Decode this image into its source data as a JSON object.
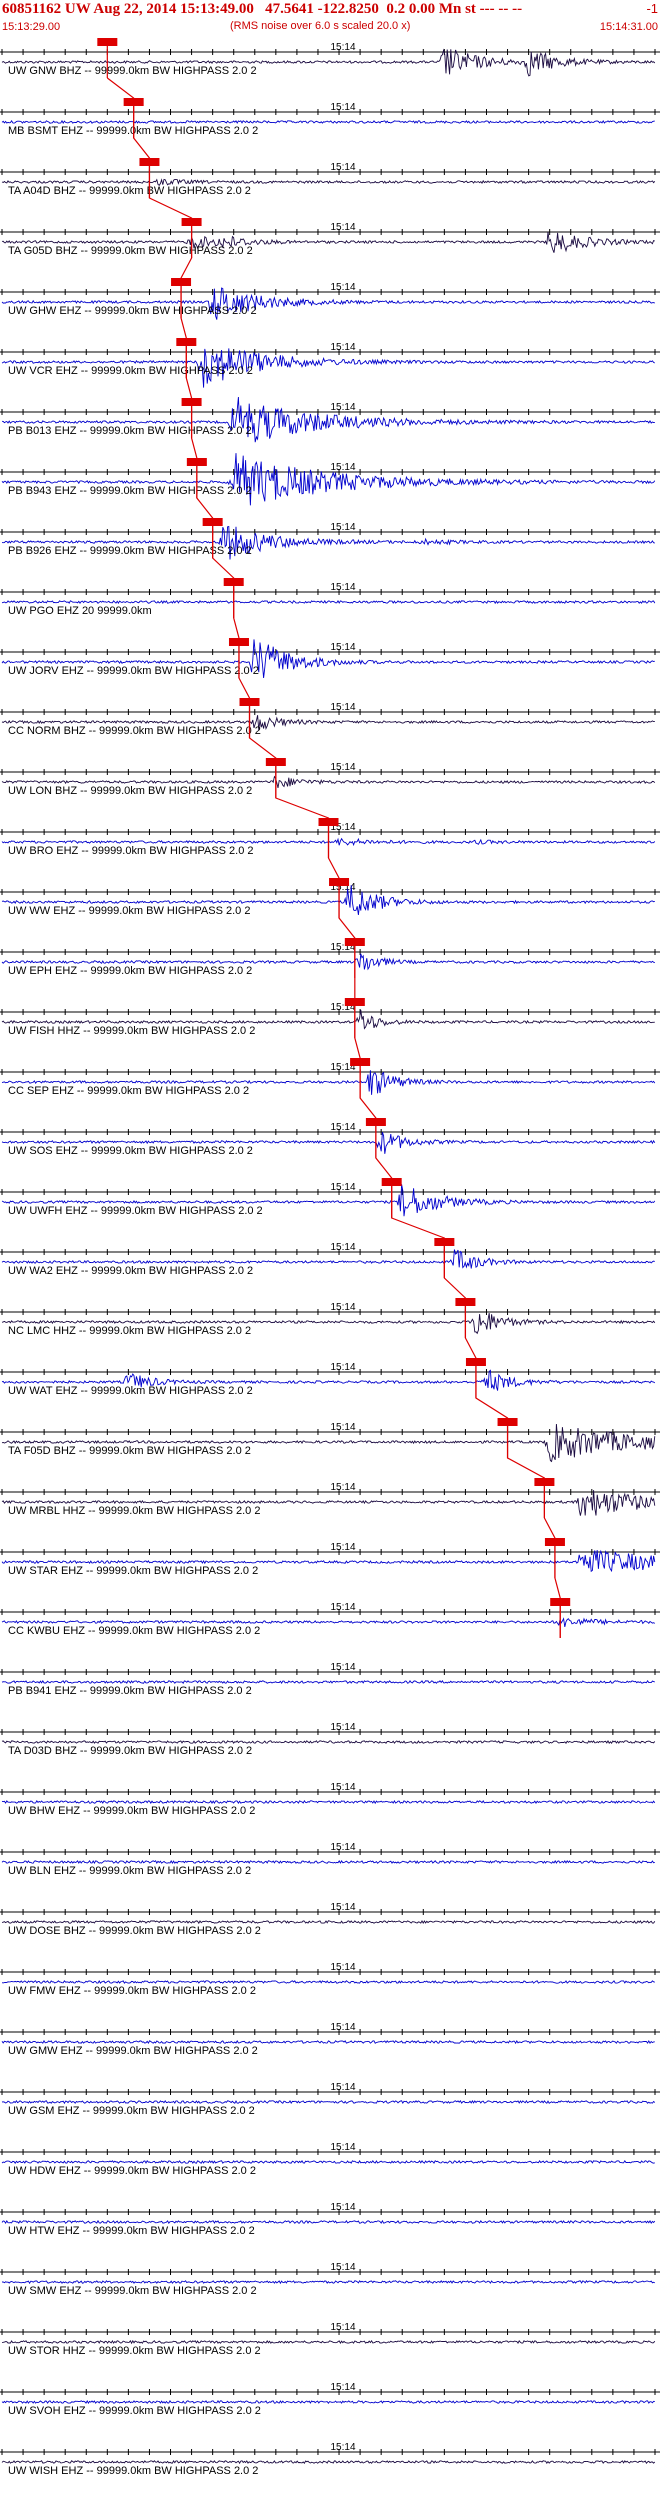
{
  "header": {
    "title": "60851162 UW Aug 22, 2014 15:13:49.00   47.5641 -122.8250  0.2 0.00 Mn st --- -- --",
    "title_suffix": "-1",
    "subtitle": "(RMS noise over 6.0 s scaled 20.0 x)",
    "time_start": "15:13:29.00",
    "time_end": "15:14:31.00",
    "tick_label": "15:14"
  },
  "colors": {
    "header_text": "#cc0000",
    "pick": "#dd0000",
    "blue_trace": "#0000cc",
    "dark_trace": "#1a0a40",
    "axis": "#000000"
  },
  "chart_data": {
    "type": "line",
    "title": "60851162 UW Aug 22, 2014 15:13:49.00",
    "xlabel": "",
    "ylabel": "",
    "xlim": [
      "15:13:29.00",
      "15:14:31.00"
    ],
    "x_tick_center": "15:14",
    "pick_label": "P",
    "series": [
      {
        "name": "UW GNW BHZ -- 99999.0km BW  HIGHPASS  2.0  2",
        "color": "dark",
        "pick_s": 10.0,
        "events": [
          [
            42,
            3,
            5
          ],
          [
            50,
            2.5,
            4
          ]
        ]
      },
      {
        "name": "MB BSMT EHZ -- 99999.0km BW  HIGHPASS  2.0  2",
        "color": "blue",
        "pick_s": 12.5,
        "events": []
      },
      {
        "name": "TA A04D BHZ -- 99999.0km BW  HIGHPASS  2.0  2",
        "color": "dark",
        "pick_s": 14.0,
        "events": [
          [
            15,
            2,
            1
          ]
        ]
      },
      {
        "name": "TA G05D BHZ -- 99999.0km BW  HIGHPASS  2.0  2",
        "color": "dark",
        "pick_s": 18.0,
        "events": [
          [
            18,
            3,
            2
          ],
          [
            21,
            2,
            1.5
          ],
          [
            52,
            3,
            4
          ]
        ]
      },
      {
        "name": "UW GHW EHZ -- 99999.0km BW  HIGHPASS  2.0  2",
        "color": "blue",
        "pick_s": 17.0,
        "events": [
          [
            20,
            4,
            6
          ]
        ]
      },
      {
        "name": "UW VCR EHZ -- 99999.0km BW  HIGHPASS  2.0  2",
        "color": "blue",
        "pick_s": 17.5,
        "events": [
          [
            19,
            5,
            8
          ]
        ]
      },
      {
        "name": "PB B013 EHZ -- 99999.0km BW  HIGHPASS  2.0  2",
        "color": "blue",
        "pick_s": 18.0,
        "events": [
          [
            22,
            7,
            8
          ]
        ]
      },
      {
        "name": "PB B943 EHZ -- 99999.0km BW  HIGHPASS  2.0  2",
        "color": "blue",
        "pick_s": 18.5,
        "events": [
          [
            22,
            8,
            9
          ]
        ]
      },
      {
        "name": "PB B926 EHZ -- 99999.0km BW  HIGHPASS  2.0  2",
        "color": "blue",
        "pick_s": 20.0,
        "events": [
          [
            21,
            4,
            6
          ],
          [
            40,
            3,
            0.6
          ]
        ]
      },
      {
        "name": "UW PGO EHZ 20 99999.0km",
        "color": "blue",
        "pick_s": 22.0,
        "events": []
      },
      {
        "name": "UW JORV EHZ -- 99999.0km BW  HIGHPASS  2.0  2",
        "color": "blue",
        "pick_s": 22.5,
        "events": [
          [
            24,
            3,
            8
          ]
        ]
      },
      {
        "name": "CC NORM BHZ -- 99999.0km BW  HIGHPASS  2.0  2",
        "color": "dark",
        "pick_s": 23.5,
        "events": [
          [
            24,
            2,
            3
          ]
        ]
      },
      {
        "name": "UW LON BHZ -- 99999.0km BW  HIGHPASS  2.0  2",
        "color": "dark",
        "pick_s": 26.0,
        "events": [
          [
            26,
            2,
            2
          ]
        ]
      },
      {
        "name": "UW BRO EHZ -- 99999.0km BW  HIGHPASS  2.0  2",
        "color": "blue",
        "pick_s": 31.0,
        "events": [
          [
            32,
            3,
            1
          ],
          [
            45,
            2,
            0.4
          ]
        ]
      },
      {
        "name": "UW WW EHZ -- 99999.0km BW  HIGHPASS  2.0  2",
        "color": "blue",
        "pick_s": 32.0,
        "events": [
          [
            33,
            2.5,
            6
          ]
        ]
      },
      {
        "name": "UW EPH EHZ -- 99999.0km BW  HIGHPASS  2.0  2",
        "color": "blue",
        "pick_s": 33.5,
        "events": [
          [
            34,
            1.5,
            4
          ]
        ]
      },
      {
        "name": "UW FISH HHZ -- 99999.0km BW  HIGHPASS  2.0  2",
        "color": "dark",
        "pick_s": 33.5,
        "events": [
          [
            34,
            1.5,
            4
          ]
        ]
      },
      {
        "name": "CC SEP EHZ -- 99999.0km BW  HIGHPASS  2.0  2",
        "color": "blue",
        "pick_s": 34.0,
        "events": [
          [
            35,
            2,
            5
          ]
        ]
      },
      {
        "name": "UW SOS EHZ -- 99999.0km BW  HIGHPASS  2.0  2",
        "color": "blue",
        "pick_s": 35.5,
        "events": [
          [
            36,
            2,
            4
          ]
        ]
      },
      {
        "name": "UW UWFH EHZ -- 99999.0km BW  HIGHPASS  2.0  2",
        "color": "blue",
        "pick_s": 37.0,
        "events": [
          [
            38,
            3,
            6
          ]
        ]
      },
      {
        "name": "UW WA2 EHZ -- 99999.0km BW  HIGHPASS  2.0  2",
        "color": "blue",
        "pick_s": 42.0,
        "events": [
          [
            43,
            2,
            4
          ]
        ]
      },
      {
        "name": "NC LMC HHZ -- 99999.0km BW  HIGHPASS  2.0  2",
        "color": "dark",
        "pick_s": 44.0,
        "events": [
          [
            45,
            2,
            5
          ]
        ]
      },
      {
        "name": "UW WAT EHZ -- 99999.0km BW  HIGHPASS  2.0  2",
        "color": "blue",
        "pick_s": 45.0,
        "events": [
          [
            12,
            2,
            3
          ],
          [
            46,
            2,
            4
          ]
        ]
      },
      {
        "name": "TA F05D BHZ -- 99999.0km BW  HIGHPASS  2.0  2",
        "color": "dark",
        "pick_s": 48.0,
        "events": [
          [
            52,
            8,
            6
          ]
        ]
      },
      {
        "name": "UW MRBL HHZ -- 99999.0km BW  HIGHPASS  2.0  2",
        "color": "dark",
        "pick_s": 51.5,
        "events": [
          [
            55,
            6,
            5
          ]
        ]
      },
      {
        "name": "UW STAR EHZ -- 99999.0km BW  HIGHPASS  2.0  2",
        "color": "blue",
        "pick_s": 52.5,
        "events": [
          [
            55,
            9,
            4
          ]
        ]
      },
      {
        "name": "CC KWBU EHZ -- 99999.0km BW  HIGHPASS  2.0  2",
        "color": "blue",
        "pick_s": 53.0,
        "events": [
          [
            53,
            3,
            1.5
          ]
        ]
      },
      {
        "name": "PB B941 EHZ -- 99999.0km BW  HIGHPASS  2.0  2",
        "color": "blue",
        "pick_s": null,
        "events": []
      },
      {
        "name": "TA D03D BHZ -- 99999.0km BW  HIGHPASS  2.0  2",
        "color": "dark",
        "pick_s": null,
        "events": []
      },
      {
        "name": "UW BHW EHZ -- 99999.0km BW  HIGHPASS  2.0  2",
        "color": "blue",
        "pick_s": null,
        "events": []
      },
      {
        "name": "UW BLN EHZ -- 99999.0km BW  HIGHPASS  2.0  2",
        "color": "blue",
        "pick_s": null,
        "events": []
      },
      {
        "name": "UW DOSE BHZ -- 99999.0km BW  HIGHPASS  2.0  2",
        "color": "dark",
        "pick_s": null,
        "events": []
      },
      {
        "name": "UW FMW EHZ -- 99999.0km BW  HIGHPASS  2.0  2",
        "color": "blue",
        "pick_s": null,
        "events": []
      },
      {
        "name": "UW GMW EHZ -- 99999.0km BW  HIGHPASS  2.0  2",
        "color": "blue",
        "pick_s": null,
        "events": []
      },
      {
        "name": "UW GSM EHZ -- 99999.0km BW  HIGHPASS  2.0  2",
        "color": "blue",
        "pick_s": null,
        "events": []
      },
      {
        "name": "UW HDW EHZ -- 99999.0km BW  HIGHPASS  2.0  2",
        "color": "blue",
        "pick_s": null,
        "events": []
      },
      {
        "name": "UW HTW EHZ -- 99999.0km BW  HIGHPASS  2.0  2",
        "color": "blue",
        "pick_s": null,
        "events": []
      },
      {
        "name": "UW SMW EHZ -- 99999.0km BW  HIGHPASS  2.0  2",
        "color": "blue",
        "pick_s": null,
        "events": []
      },
      {
        "name": "UW STOR HHZ -- 99999.0km BW  HIGHPASS  2.0  2",
        "color": "dark",
        "pick_s": null,
        "events": []
      },
      {
        "name": "UW SVOH EHZ -- 99999.0km BW  HIGHPASS  2.0  2",
        "color": "blue",
        "pick_s": null,
        "events": []
      },
      {
        "name": "UW WISH EHZ -- 99999.0km BW  HIGHPASS  2.0  2",
        "color": "dark",
        "pick_s": null,
        "events": []
      }
    ]
  }
}
